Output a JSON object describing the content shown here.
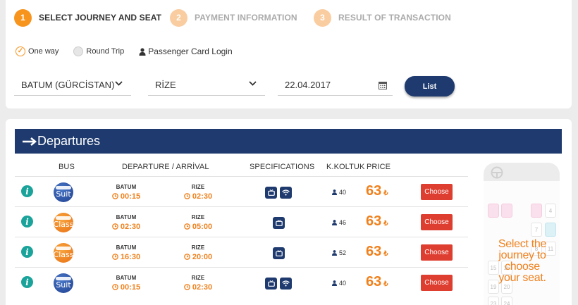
{
  "steps": [
    {
      "num": "1",
      "label": "SELECT JOURNEY AND SEAT"
    },
    {
      "num": "2",
      "label": "PAYMENT INFORMATION"
    },
    {
      "num": "3",
      "label": "RESULT OF TRANSACTION"
    }
  ],
  "trip_type": {
    "one_way": "One way",
    "round_trip": "Round Trip",
    "selected": "One way"
  },
  "passenger_login": "Passenger Card Login",
  "search": {
    "from": "BATUM (GÜRCİSTAN)",
    "to": "RİZE",
    "date": "22.04.2017",
    "list_button": "List"
  },
  "departures": {
    "title": "Departures",
    "headers": {
      "bus": "BUS",
      "dep_arr": "DEPARTURE / ARRİVAL",
      "specs": "SPECIFICATIONS",
      "seats": "K.KOLTUK",
      "price": "PRICE"
    },
    "rows": [
      {
        "logo": "Suit",
        "from": "BATUM",
        "dep_time": "00:15",
        "to": "RIZE",
        "arr_time": "02:30",
        "specs": [
          "tv-icon",
          "wifi-icon"
        ],
        "seats": "40",
        "price": "63",
        "currency": "₺",
        "choose": "Choose"
      },
      {
        "logo": "Class",
        "from": "BATUM",
        "dep_time": "02:30",
        "to": "RIZE",
        "arr_time": "05:00",
        "specs": [
          "tv-icon"
        ],
        "seats": "46",
        "price": "63",
        "currency": "₺",
        "choose": "Choose"
      },
      {
        "logo": "Class",
        "from": "BATUM",
        "dep_time": "16:30",
        "to": "RIZE",
        "arr_time": "20:00",
        "specs": [
          "tv-icon"
        ],
        "seats": "52",
        "price": "63",
        "currency": "₺",
        "choose": "Choose"
      },
      {
        "logo": "Suit",
        "from": "BATUM",
        "dep_time": "00:15",
        "to": "RIZE",
        "arr_time": "02:30",
        "specs": [
          "tv-icon",
          "wifi-icon"
        ],
        "seats": "40",
        "price": "63",
        "currency": "₺",
        "choose": "Choose"
      }
    ]
  },
  "bus_panel": {
    "message": "Select the journey to choose your seat.",
    "seat_numbers": [
      "4",
      "7",
      "8",
      "11",
      "15",
      "16",
      "19",
      "20",
      "23",
      "24"
    ]
  },
  "colors": {
    "navy": "#1e3a6e",
    "orange": "#f7941d",
    "red": "#de3e30",
    "teal": "#1aa39a"
  }
}
